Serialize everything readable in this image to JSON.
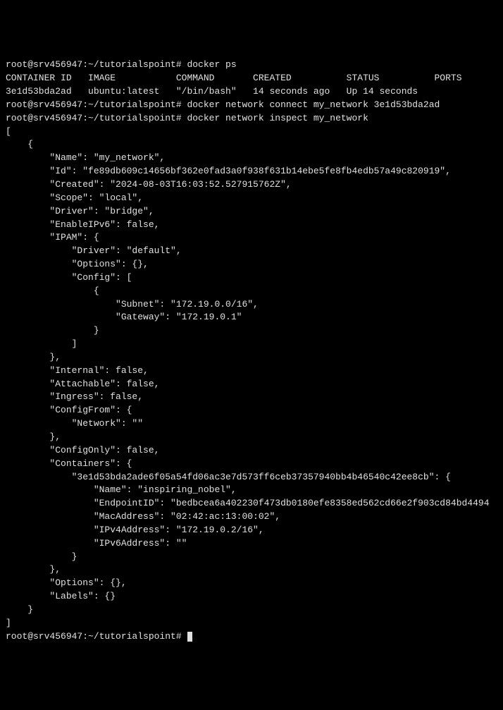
{
  "lines": [
    "root@srv456947:~/tutorialspoint# docker ps",
    "CONTAINER ID   IMAGE           COMMAND       CREATED          STATUS          PORTS",
    "3e1d53bda2ad   ubuntu:latest   \"/bin/bash\"   14 seconds ago   Up 14 seconds",
    "root@srv456947:~/tutorialspoint# docker network connect my_network 3e1d53bda2ad",
    "root@srv456947:~/tutorialspoint# docker network inspect my_network",
    "[",
    "    {",
    "        \"Name\": \"my_network\",",
    "        \"Id\": \"fe89db609c14656bf362e0fad3a0f938f631b14ebe5fe8fb4edb57a49c820919\",",
    "        \"Created\": \"2024-08-03T16:03:52.527915762Z\",",
    "        \"Scope\": \"local\",",
    "        \"Driver\": \"bridge\",",
    "        \"EnableIPv6\": false,",
    "        \"IPAM\": {",
    "            \"Driver\": \"default\",",
    "            \"Options\": {},",
    "            \"Config\": [",
    "                {",
    "                    \"Subnet\": \"172.19.0.0/16\",",
    "                    \"Gateway\": \"172.19.0.1\"",
    "                }",
    "            ]",
    "        },",
    "        \"Internal\": false,",
    "        \"Attachable\": false,",
    "        \"Ingress\": false,",
    "        \"ConfigFrom\": {",
    "            \"Network\": \"\"",
    "        },",
    "        \"ConfigOnly\": false,",
    "        \"Containers\": {",
    "            \"3e1d53bda2ade6f05a54fd06ac3e7d573ff6ceb37357940bb4b46540c42ee8cb\": {",
    "                \"Name\": \"inspiring_nobel\",",
    "                \"EndpointID\": \"bedbcea6a402230f473db0180efe8358ed562cd66e2f903cd84bd4494",
    "                \"MacAddress\": \"02:42:ac:13:00:02\",",
    "                \"IPv4Address\": \"172.19.0.2/16\",",
    "                \"IPv6Address\": \"\"",
    "            }",
    "        },",
    "        \"Options\": {},",
    "        \"Labels\": {}",
    "    }",
    "]",
    "root@srv456947:~/tutorialspoint# "
  ]
}
